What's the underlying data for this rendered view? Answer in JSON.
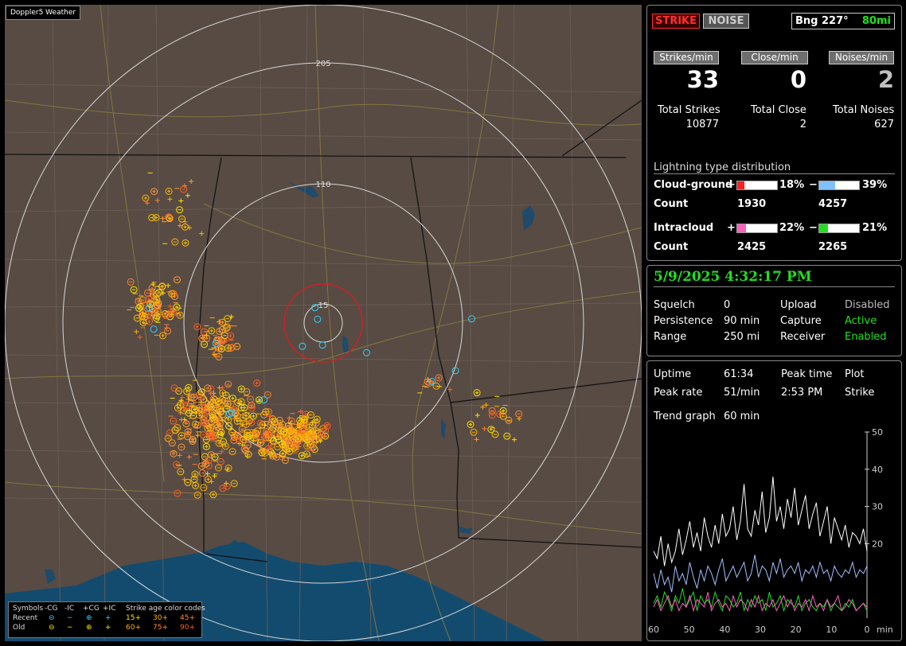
{
  "app_title": "Doppler5 Weather",
  "map": {
    "range_labels": [
      "205",
      "110",
      "15"
    ],
    "legend": {
      "symbols_label": "Symbols",
      "types": [
        "-CG",
        "-IC",
        "+CG",
        "+IC"
      ],
      "age_label": "Strike age color codes",
      "row_labels": [
        "Recent",
        "Old"
      ],
      "recent_ages": [
        "15+",
        "30+",
        "45+"
      ],
      "old_ages": [
        "60+",
        "75+",
        "90+"
      ],
      "age_colors": {
        "15+": "#ffe000",
        "30+": "#ffb000",
        "45+": "#ff8a30",
        "60+": "#ffb000",
        "75+": "#ff8a30",
        "90+": "#ff6020"
      }
    }
  },
  "mode": {
    "strike_label": "STRIKE",
    "noise_label": "NOISE",
    "bearing": "Bng 227°",
    "distance": "80mi"
  },
  "rates": [
    {
      "header": "Strikes/min",
      "value": "33",
      "total_label": "Total Strikes",
      "total": "10877",
      "color": "#ffffff"
    },
    {
      "header": "Close/min",
      "value": "0",
      "total_label": "Total Close",
      "total": "2",
      "color": "#ffffff"
    },
    {
      "header": "Noises/min",
      "value": "2",
      "total_label": "Total Noises",
      "total": "627",
      "color": "#c0c0c0"
    }
  ],
  "distribution": {
    "title": "Lightning type distribution",
    "cg_label": "Cloud-ground",
    "ic_label": "Intracloud",
    "count_label": "Count",
    "plus_sign": "+",
    "minus_sign": "−",
    "cg_pos_pct": "18%",
    "cg_neg_pct": "39%",
    "cg_pos_count": "1930",
    "cg_neg_count": "4257",
    "ic_pos_pct": "22%",
    "ic_neg_pct": "21%",
    "ic_pos_count": "2425",
    "ic_neg_count": "2265",
    "cg_pos_fraction": 0.18,
    "cg_neg_fraction": 0.39,
    "ic_pos_fraction": 0.22,
    "ic_neg_fraction": 0.21,
    "colors": {
      "cg_pos": "#ff2020",
      "cg_neg": "#80c0ff",
      "ic_pos": "#ff60c0",
      "ic_neg": "#20e020"
    }
  },
  "status": {
    "datetime": "5/9/2025 4:32:17 PM",
    "squelch_label": "Squelch",
    "squelch": "0",
    "persistence_label": "Persistence",
    "persistence": "90 min",
    "range_label": "Range",
    "range": "250 mi",
    "upload_label": "Upload",
    "upload": "Disabled",
    "capture_label": "Capture",
    "capture": "Active",
    "receiver_label": "Receiver",
    "receiver": "Enabled"
  },
  "stats": {
    "uptime_label": "Uptime",
    "uptime": "61:34",
    "peak_time_label": "Peak time",
    "peak_time": "2:53 PM",
    "plot_label": "Plot",
    "plot": "Strike",
    "peak_rate_label": "Peak rate",
    "peak_rate": "51/min",
    "trend_label": "Trend graph",
    "trend": "60 min"
  },
  "chart_data": {
    "type": "line",
    "x_tick_labels": [
      "60",
      "50",
      "40",
      "30",
      "20",
      "10",
      "0"
    ],
    "x_unit": "min",
    "y_tick_labels": [
      "50",
      "40",
      "30",
      "20"
    ],
    "xlim": [
      60,
      0
    ],
    "ylim": [
      0,
      50
    ],
    "series": [
      {
        "color": "#ffffff",
        "values": [
          18,
          16,
          22,
          14,
          20,
          15,
          18,
          24,
          17,
          21,
          26,
          19,
          23,
          18,
          27,
          22,
          19,
          25,
          20,
          28,
          22,
          24,
          30,
          21,
          26,
          36,
          24,
          22,
          29,
          25,
          34,
          23,
          27,
          38,
          26,
          30,
          24,
          32,
          27,
          35,
          25,
          29,
          33,
          24,
          28,
          31,
          22,
          26,
          30,
          20,
          27,
          24,
          21,
          25,
          19,
          23,
          22,
          20,
          24,
          18
        ]
      },
      {
        "color": "#9fc0ff",
        "values": [
          12,
          8,
          13,
          9,
          11,
          7,
          14,
          10,
          12,
          9,
          15,
          11,
          8,
          13,
          10,
          14,
          12,
          9,
          13,
          16,
          10,
          12,
          14,
          11,
          13,
          15,
          10,
          12,
          17,
          11,
          14,
          13,
          10,
          15,
          12,
          16,
          11,
          13,
          14,
          12,
          15,
          10,
          13,
          12,
          14,
          11,
          15,
          12,
          13,
          10,
          14,
          12,
          11,
          13,
          12,
          15,
          11,
          13,
          12,
          14
        ]
      },
      {
        "color": "#20e020",
        "values": [
          4,
          6,
          3,
          7,
          5,
          2,
          6,
          4,
          8,
          3,
          5,
          7,
          2,
          6,
          4,
          5,
          3,
          7,
          4,
          2,
          6,
          5,
          3,
          4,
          7,
          2,
          5,
          3,
          6,
          4,
          5,
          2,
          7,
          3,
          4,
          6,
          2,
          5,
          4,
          3,
          6,
          2,
          4,
          5,
          3,
          2,
          4,
          3,
          5,
          2,
          4,
          3,
          2,
          4,
          3,
          5,
          2,
          3,
          4,
          2
        ]
      },
      {
        "color": "#ff60c0",
        "values": [
          3,
          5,
          2,
          4,
          6,
          3,
          5,
          2,
          4,
          3,
          6,
          2,
          5,
          4,
          3,
          7,
          2,
          4,
          5,
          3,
          4,
          2,
          6,
          3,
          5,
          4,
          2,
          5,
          3,
          6,
          2,
          4,
          3,
          5,
          2,
          4,
          6,
          3,
          5,
          2,
          4,
          3,
          5,
          2,
          6,
          3,
          4,
          2,
          5,
          3,
          4,
          6,
          2,
          3,
          5,
          4,
          2,
          3,
          4,
          3
        ]
      }
    ]
  }
}
